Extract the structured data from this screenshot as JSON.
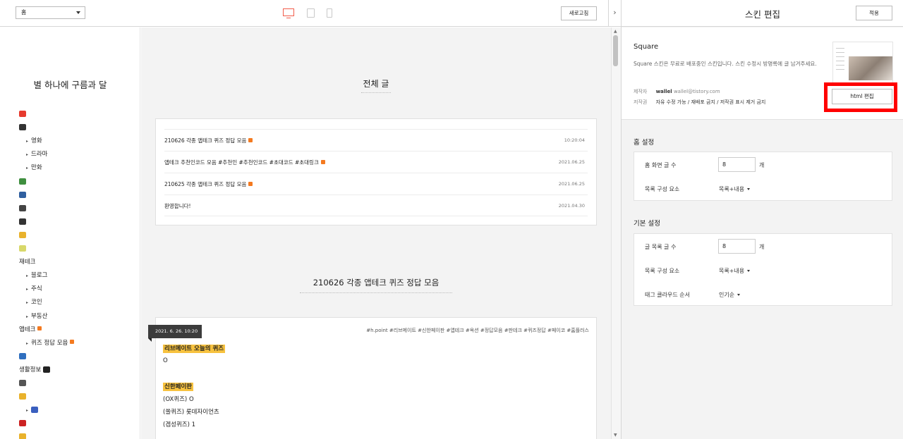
{
  "toolbar": {
    "page_select": "홈",
    "devices": [
      "desktop",
      "tablet",
      "mobile"
    ],
    "refresh_label": "새로고침",
    "collapse_label": "›"
  },
  "blog": {
    "title": "별 하나에 구름과 달",
    "menu": [
      {
        "label": "",
        "icon": "pin-emoji",
        "color": "#e63a2e"
      },
      {
        "label": "",
        "icon": "clapper-emoji",
        "color": "#333333"
      },
      {
        "label": "영화",
        "sub": true
      },
      {
        "label": "드라마",
        "sub": true
      },
      {
        "label": "만화",
        "sub": true
      },
      {
        "label": "",
        "icon": "books-emoji",
        "color": "#3f8f3f"
      },
      {
        "label": "",
        "icon": "puzzle-emoji",
        "color": "#2f5f9f"
      },
      {
        "label": "",
        "icon": "gamepad-emoji",
        "color": "#444444"
      },
      {
        "label": "",
        "icon": "magnifier-emoji",
        "color": "#333333"
      },
      {
        "label": "",
        "icon": "note-emoji",
        "color": "#e9b22c"
      },
      {
        "label": "",
        "icon": "rice-emoji",
        "color": "#d8d86a"
      },
      {
        "label": "재테크"
      },
      {
        "label": "블로그",
        "sub": true
      },
      {
        "label": "주식",
        "sub": true
      },
      {
        "label": "코인",
        "sub": true
      },
      {
        "label": "부동산",
        "sub": true
      },
      {
        "label": "앱테크",
        "badge": true
      },
      {
        "label": "퀴즈 정답 모음",
        "sub": true,
        "badge": true
      },
      {
        "label": "",
        "icon": "plane-emoji",
        "color": "#2f6fbf"
      },
      {
        "label": "생활정보",
        "icon": "eyes-emoji",
        "color": "#222222"
      },
      {
        "label": "",
        "icon": "gear-emoji",
        "color": "#555555"
      },
      {
        "label": "",
        "icon": "arm-emoji",
        "color": "#e9b22c"
      },
      {
        "label": "",
        "sub": true,
        "icon": "blue-emoji",
        "color": "#3a5fbf"
      },
      {
        "label": "",
        "icon": "red-emoji",
        "color": "#cc2222"
      },
      {
        "label": "",
        "icon": "faces-emoji",
        "color": "#e9b22c"
      }
    ]
  },
  "main": {
    "section_heading": "전체 글",
    "posts": [
      {
        "title": "210626 각종 앱테크 퀴즈 정답 모음",
        "badge": true,
        "date": "10:20:04"
      },
      {
        "title": "앱테크 추천인코드 모음 #추천인 #추천인코드 #초대코드 #초대링크",
        "badge": true,
        "date": "2021.06.25"
      },
      {
        "title": "210625 각종 앱테크 퀴즈 정답 모음",
        "badge": true,
        "date": "2021.06.25"
      },
      {
        "title": "환영합니다!",
        "badge": false,
        "date": "2021.04.30"
      }
    ],
    "article": {
      "heading": "210626 각종 앱테크 퀴즈 정답 모음",
      "date_tag": "2021. 6. 26. 10:20",
      "tags": "#h.point  #리브메이트  #신한페이판  #앱테크  #옥션  #정답모음  #판테크  #퀴즈정답  #페이코  #홈플러스",
      "lines": [
        {
          "text": "리브메이트 오늘의 퀴즈",
          "highlight": true
        },
        {
          "text": "O",
          "highlight": false
        },
        {
          "text": "",
          "highlight": false
        },
        {
          "text": "신한페이판",
          "highlight": true
        },
        {
          "text": "(OX퀴즈) O",
          "highlight": false
        },
        {
          "text": "(쏠퀴즈) 롯데자이언츠",
          "highlight": false
        },
        {
          "text": "(겜성퀴즈) 1",
          "highlight": false
        }
      ]
    }
  },
  "panel": {
    "title": "스킨 편집",
    "apply_label": "적용",
    "skin": {
      "name": "Square",
      "description": "Square 스킨은 무료로 배포중인 스킨입니다. 스킨 수정시 방명록에 글 남겨주세요.",
      "author_label": "제작자",
      "author_name": "wallel",
      "author_email": "wallel@tistory.com",
      "license_label": "저작권",
      "license": "자유 수정 가능 / 재배포 금지 / 저작권 표시 제거 금지",
      "html_edit_label": "html 편집",
      "highlight_color": "#ff0000"
    },
    "home_settings": {
      "title": "홈 설정",
      "post_count_label": "홈 화면 글 수",
      "post_count": "8",
      "unit": "개",
      "list_label": "목록 구성 요소",
      "list_value": "목록+내용"
    },
    "basic_settings": {
      "title": "기본 설정",
      "post_count_label": "글 목록 글 수",
      "post_count": "8",
      "unit": "개",
      "list_label": "목록 구성 요소",
      "list_value": "목록+내용",
      "tagcloud_label": "태그 클라우드 순서",
      "tagcloud_value": "인기순"
    }
  }
}
